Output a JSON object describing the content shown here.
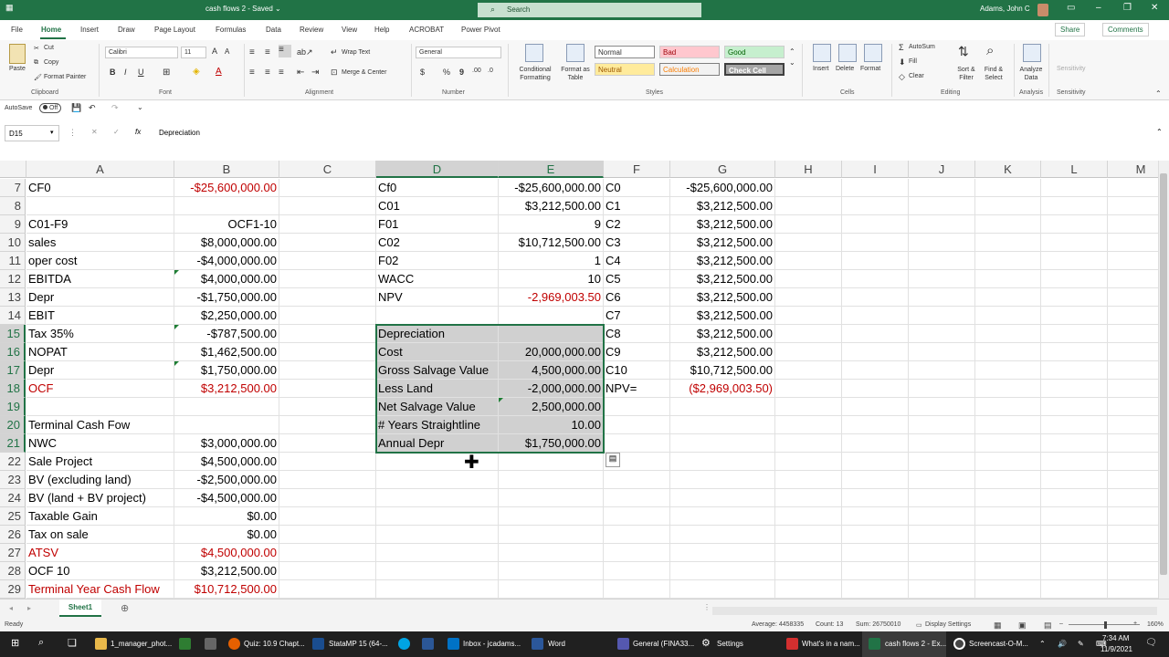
{
  "titlebar": {
    "doc_title": "cash flows 2 - Saved ⌄",
    "search_placeholder": "Search",
    "user": "Adams, John C"
  },
  "menu": {
    "tabs": [
      "File",
      "Home",
      "Insert",
      "Draw",
      "Page Layout",
      "Formulas",
      "Data",
      "Review",
      "View",
      "Help",
      "ACROBAT",
      "Power Pivot"
    ],
    "active": "Home",
    "share": "Share",
    "comments": "Comments"
  },
  "ribbon": {
    "clipboard": {
      "paste": "Paste",
      "cut": "Cut",
      "copy": "Copy",
      "format_painter": "Format Painter",
      "label": "Clipboard"
    },
    "font": {
      "name": "Calibri",
      "size": "11",
      "label": "Font",
      "bold": "B",
      "italic": "I",
      "underline": "U"
    },
    "alignment": {
      "wrap": "Wrap Text",
      "merge": "Merge & Center",
      "label": "Alignment"
    },
    "number": {
      "format": "General",
      "label": "Number",
      "currency": "$",
      "percent": "%",
      "comma": "9"
    },
    "styles": {
      "conditional": "Conditional Formatting",
      "format_table": "Format as Table",
      "normal": "Normal",
      "bad": "Bad",
      "good": "Good",
      "neutral": "Neutral",
      "calculation": "Calculation",
      "check_cell": "Check Cell",
      "label": "Styles"
    },
    "cells": {
      "insert": "Insert",
      "delete": "Delete",
      "format": "Format",
      "label": "Cells"
    },
    "editing": {
      "autosum": "AutoSum",
      "fill": "Fill",
      "clear": "Clear",
      "sort": "Sort & Filter",
      "find": "Find & Select",
      "label": "Editing"
    },
    "analysis": {
      "analyze": "Analyze Data",
      "label": "Analysis"
    },
    "sensitivity": {
      "sens": "Sensitivity",
      "label": "Sensitivity"
    }
  },
  "qat": {
    "autosave": "AutoSave",
    "toggle": "Off"
  },
  "formula_bar": {
    "name_box": "D15",
    "content": "Depreciation",
    "fx": "fx"
  },
  "columns": [
    "A",
    "B",
    "C",
    "D",
    "E",
    "F",
    "G",
    "H",
    "I",
    "J",
    "K",
    "L",
    "M"
  ],
  "rows": [
    {
      "n": "7",
      "A": "CF0",
      "B": "-$25,600,000.00",
      "D": "Cf0",
      "E": "-$25,600,000.00",
      "F": "C0",
      "G": "-$25,600,000.00"
    },
    {
      "n": "8",
      "A": "",
      "B": "",
      "D": "C01",
      "E": "$3,212,500.00",
      "F": "C1",
      "G": "$3,212,500.00"
    },
    {
      "n": "9",
      "A": "C01-F9",
      "B": "OCF1-10",
      "D": "F01",
      "E": "9",
      "F": "C2",
      "G": "$3,212,500.00"
    },
    {
      "n": "10",
      "A": "sales",
      "B": "$8,000,000.00",
      "D": "C02",
      "E": "$10,712,500.00",
      "F": "C3",
      "G": "$3,212,500.00"
    },
    {
      "n": "11",
      "A": "oper cost",
      "B": "-$4,000,000.00",
      "D": "F02",
      "E": "1",
      "F": "C4",
      "G": "$3,212,500.00"
    },
    {
      "n": "12",
      "A": "EBITDA",
      "B": "$4,000,000.00",
      "D": "WACC",
      "E": "10",
      "F": "C5",
      "G": "$3,212,500.00"
    },
    {
      "n": "13",
      "A": "Depr",
      "B": "-$1,750,000.00",
      "D": "NPV",
      "E": "-2,969,003.50",
      "F": "C6",
      "G": "$3,212,500.00"
    },
    {
      "n": "14",
      "A": "EBIT",
      "B": "$2,250,000.00",
      "D": "",
      "E": "",
      "F": "C7",
      "G": "$3,212,500.00"
    },
    {
      "n": "15",
      "A": "Tax 35%",
      "B": "-$787,500.00",
      "D": "Depreciation",
      "E": "",
      "F": "C8",
      "G": "$3,212,500.00"
    },
    {
      "n": "16",
      "A": "NOPAT",
      "B": "$1,462,500.00",
      "D": "Cost",
      "E": "20,000,000.00",
      "F": "C9",
      "G": "$3,212,500.00"
    },
    {
      "n": "17",
      "A": "Depr",
      "B": "$1,750,000.00",
      "D": "Gross Salvage Value",
      "E": "4,500,000.00",
      "F": "C10",
      "G": "$10,712,500.00"
    },
    {
      "n": "18",
      "A": "OCF",
      "B": "$3,212,500.00",
      "D": "Less Land",
      "E": "-2,000,000.00",
      "F": "NPV=",
      "G": "($2,969,003.50)"
    },
    {
      "n": "19",
      "A": "",
      "B": "",
      "D": "Net Salvage Value",
      "E": "2,500,000.00",
      "F": "",
      "G": ""
    },
    {
      "n": "20",
      "A": "Terminal Cash Fow",
      "B": "",
      "D": "# Years Straightline",
      "E": "10.00",
      "F": "",
      "G": ""
    },
    {
      "n": "21",
      "A": "NWC",
      "B": "$3,000,000.00",
      "D": "Annual Depr",
      "E": "$1,750,000.00",
      "F": "",
      "G": ""
    },
    {
      "n": "22",
      "A": "Sale Project",
      "B": "$4,500,000.00",
      "D": "",
      "E": "",
      "F": "",
      "G": ""
    },
    {
      "n": "23",
      "A": "BV (excluding land)",
      "B": "-$2,500,000.00",
      "D": "",
      "E": "",
      "F": "",
      "G": ""
    },
    {
      "n": "24",
      "A": "BV (land + BV project)",
      "B": "-$4,500,000.00",
      "D": "",
      "E": "",
      "F": "",
      "G": ""
    },
    {
      "n": "25",
      "A": "Taxable Gain",
      "B": "$0.00",
      "D": "",
      "E": "",
      "F": "",
      "G": ""
    },
    {
      "n": "26",
      "A": "Tax on sale",
      "B": "$0.00",
      "D": "",
      "E": "",
      "F": "",
      "G": ""
    },
    {
      "n": "27",
      "A": "ATSV",
      "B": "$4,500,000.00",
      "D": "",
      "E": "",
      "F": "",
      "G": ""
    },
    {
      "n": "28",
      "A": "OCF 10",
      "B": "$3,212,500.00",
      "D": "",
      "E": "",
      "F": "",
      "G": ""
    },
    {
      "n": "29",
      "A": "Terminal Year Cash Flow",
      "B": "$10,712,500.00",
      "D": "",
      "E": "",
      "F": "",
      "G": ""
    }
  ],
  "sheet": {
    "tab": "Sheet1"
  },
  "status": {
    "ready": "Ready",
    "average": "Average: 4458335",
    "count": "Count: 13",
    "sum": "Sum: 26750010",
    "display": "Display Settings",
    "zoom": "160%"
  },
  "taskbar": {
    "items": [
      "1_manager_phot...",
      "Quiz: 10.9 Chapt...",
      "StataMP 15 (64-...",
      "Inbox - jcadams...",
      "Word",
      "General (FINA33...",
      "Settings",
      "What's in a nam...",
      "cash flows 2 - Ex...",
      "Screencast-O-M..."
    ],
    "time": "7:34 AM",
    "date": "11/9/2021"
  },
  "colors": {
    "excel_green": "#217346",
    "red_text": "#c00000",
    "shade": "#d0d0d0"
  }
}
